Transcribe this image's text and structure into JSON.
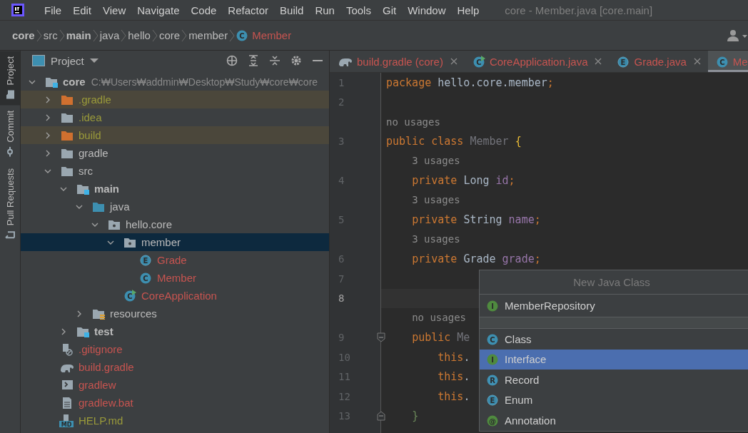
{
  "window": {
    "title": "core - Member.java [core.main]"
  },
  "menu": [
    "File",
    "Edit",
    "View",
    "Navigate",
    "Code",
    "Refactor",
    "Build",
    "Run",
    "Tools",
    "Git",
    "Window",
    "Help"
  ],
  "breadcrumb": [
    {
      "label": "core",
      "bold": true,
      "kind": "directory"
    },
    {
      "label": "src",
      "bold": false,
      "kind": "directory"
    },
    {
      "label": "main",
      "bold": true,
      "kind": "directory"
    },
    {
      "label": "java",
      "bold": false,
      "kind": "directory"
    },
    {
      "label": "hello",
      "bold": false,
      "kind": "directory"
    },
    {
      "label": "core",
      "bold": false,
      "kind": "directory"
    },
    {
      "label": "member",
      "bold": false,
      "kind": "directory"
    },
    {
      "label": "Member",
      "bold": false,
      "kind": "class",
      "badge": "C"
    }
  ],
  "tool_tabs": [
    {
      "label": "Project",
      "selected": true
    },
    {
      "label": "Commit",
      "selected": false
    },
    {
      "label": "Pull Requests",
      "selected": false
    }
  ],
  "project_panel": {
    "title": "Project",
    "tree": [
      {
        "name": "core",
        "path": "C:₩Users₩addmin₩Desktop₩Study₩core₩core",
        "kind": "module",
        "color": "#bbbbbb",
        "excluded": false,
        "expanded": true,
        "selected": false,
        "children": [
          {
            "name": ".gradle",
            "kind": "excluded-folder",
            "color": "#9a9a3a",
            "excluded": true,
            "expanded": false,
            "selected": false
          },
          {
            "name": ".idea",
            "kind": "folder",
            "color": "#9a9a3a",
            "excluded": false,
            "expanded": false,
            "selected": false
          },
          {
            "name": "build",
            "kind": "excluded-folder",
            "color": "#9a9a3a",
            "excluded": true,
            "expanded": false,
            "selected": false
          },
          {
            "name": "gradle",
            "kind": "folder",
            "color": "#bbbbbb",
            "excluded": false,
            "expanded": false,
            "selected": false
          },
          {
            "name": "src",
            "kind": "folder",
            "color": "#bbbbbb",
            "excluded": false,
            "expanded": true,
            "selected": false,
            "children": [
              {
                "name": "main",
                "kind": "source-root",
                "color": "#bbbbbb",
                "excluded": false,
                "expanded": true,
                "selected": false,
                "children": [
                  {
                    "name": "java",
                    "kind": "java-folder",
                    "color": "#bbbbbb",
                    "excluded": false,
                    "expanded": true,
                    "selected": false,
                    "children": [
                      {
                        "name": "hello.core",
                        "kind": "package",
                        "color": "#bbbbbb",
                        "excluded": false,
                        "expanded": true,
                        "selected": false,
                        "children": [
                          {
                            "name": "member",
                            "kind": "package",
                            "color": "#bbbbbb",
                            "excluded": false,
                            "expanded": true,
                            "selected": true,
                            "children": [
                              {
                                "name": "Grade",
                                "kind": "enum",
                                "badge": "E",
                                "color": "#c75450",
                                "excluded": false,
                                "selected": false
                              },
                              {
                                "name": "Member",
                                "kind": "class",
                                "badge": "C",
                                "color": "#c75450",
                                "excluded": false,
                                "selected": false
                              }
                            ]
                          },
                          {
                            "name": "CoreApplication",
                            "kind": "app-class",
                            "badge": "C",
                            "color": "#c75450",
                            "excluded": false,
                            "selected": false
                          }
                        ]
                      }
                    ]
                  },
                  {
                    "name": "resources",
                    "kind": "resources",
                    "color": "#bbbbbb",
                    "excluded": false,
                    "expanded": false,
                    "selected": false
                  }
                ]
              },
              {
                "name": "test",
                "kind": "source-root",
                "color": "#bbbbbb",
                "excluded": false,
                "expanded": false,
                "selected": false
              }
            ]
          },
          {
            "name": ".gitignore",
            "kind": "gitignore",
            "color": "#c75450",
            "excluded": false,
            "selected": false
          },
          {
            "name": "build.gradle",
            "kind": "gradle",
            "color": "#c75450",
            "excluded": false,
            "selected": false
          },
          {
            "name": "gradlew",
            "kind": "script",
            "color": "#c75450",
            "excluded": false,
            "selected": false
          },
          {
            "name": "gradlew.bat",
            "kind": "text",
            "color": "#c75450",
            "excluded": false,
            "selected": false
          },
          {
            "name": "HELP.md",
            "kind": "markdown",
            "badge": "MD",
            "color": "#9a9a3a",
            "excluded": false,
            "selected": false
          }
        ]
      }
    ]
  },
  "editor_tabs": [
    {
      "label": "build.gradle (core)",
      "kind": "gradle",
      "selected": false
    },
    {
      "label": "CoreApplication.java",
      "kind": "app-class",
      "badge": "C",
      "selected": false
    },
    {
      "label": "Grade.java",
      "kind": "enum",
      "badge": "E",
      "selected": false
    },
    {
      "label": "Me",
      "kind": "class",
      "badge": "C",
      "selected": true
    }
  ],
  "code": [
    {
      "kind": "line",
      "number": "1",
      "current": false,
      "fold_start": false,
      "fold_end": false,
      "tokens": [
        {
          "kind": "keyword",
          "text": "package"
        },
        {
          "kind": "plain",
          "text": " hello.core.member"
        },
        {
          "kind": "keyword",
          "text": ";"
        }
      ]
    },
    {
      "kind": "line",
      "number": "2",
      "current": false,
      "fold_start": false,
      "fold_end": false
    },
    {
      "kind": "hint",
      "text": "no usages"
    },
    {
      "kind": "line",
      "number": "3",
      "current": false,
      "fold_start": false,
      "fold_end": false,
      "tokens": [
        {
          "kind": "keyword",
          "text": "public class"
        },
        {
          "kind": "unused",
          "text": " Member"
        },
        {
          "kind": "brace",
          "text": " {"
        }
      ]
    },
    {
      "kind": "hint",
      "text": "    3 usages"
    },
    {
      "kind": "line",
      "number": "4",
      "current": false,
      "fold_start": false,
      "fold_end": false,
      "tokens": [
        {
          "kind": "keyword",
          "text": "    private"
        },
        {
          "kind": "plain",
          "text": " Long"
        },
        {
          "kind": "field",
          "text": " id"
        },
        {
          "kind": "keyword",
          "text": ";"
        }
      ]
    },
    {
      "kind": "hint",
      "text": "    3 usages"
    },
    {
      "kind": "line",
      "number": "5",
      "current": false,
      "fold_start": false,
      "fold_end": false,
      "tokens": [
        {
          "kind": "keyword",
          "text": "    private"
        },
        {
          "kind": "plain",
          "text": " String"
        },
        {
          "kind": "field",
          "text": " name"
        },
        {
          "kind": "keyword",
          "text": ";"
        }
      ]
    },
    {
      "kind": "hint",
      "text": "    3 usages"
    },
    {
      "kind": "line",
      "number": "6",
      "current": false,
      "fold_start": false,
      "fold_end": false,
      "tokens": [
        {
          "kind": "keyword",
          "text": "    private"
        },
        {
          "kind": "plain",
          "text": " Grade"
        },
        {
          "kind": "field",
          "text": " grade"
        },
        {
          "kind": "keyword",
          "text": ";"
        }
      ]
    },
    {
      "kind": "line",
      "number": "7",
      "current": false,
      "fold_start": false,
      "fold_end": false
    },
    {
      "kind": "line",
      "number": "8",
      "current": true,
      "fold_start": false,
      "fold_end": false
    },
    {
      "kind": "hint",
      "text": "    no usages"
    },
    {
      "kind": "line",
      "number": "9",
      "current": false,
      "fold_start": true,
      "fold_end": false,
      "tokens": [
        {
          "kind": "keyword",
          "text": "    public"
        },
        {
          "kind": "unused",
          "text": " Me"
        }
      ]
    },
    {
      "kind": "line",
      "number": "10",
      "current": false,
      "fold_start": false,
      "fold_end": false,
      "tokens": [
        {
          "kind": "keyword",
          "text": "        this"
        },
        {
          "kind": "plain",
          "text": "."
        }
      ]
    },
    {
      "kind": "line",
      "number": "11",
      "current": false,
      "fold_start": false,
      "fold_end": false,
      "tokens": [
        {
          "kind": "keyword",
          "text": "        this"
        },
        {
          "kind": "plain",
          "text": "."
        }
      ]
    },
    {
      "kind": "line",
      "number": "12",
      "current": false,
      "fold_start": false,
      "fold_end": false,
      "tokens": [
        {
          "kind": "keyword",
          "text": "        this"
        },
        {
          "kind": "plain",
          "text": "."
        }
      ]
    },
    {
      "kind": "line",
      "number": "13",
      "current": false,
      "fold_start": false,
      "fold_end": true,
      "tokens": [
        {
          "kind": "matched-brace",
          "text": "    }"
        }
      ]
    }
  ],
  "popup": {
    "title": "New Java Class",
    "name_item": {
      "label": "MemberRepository",
      "kind": "interface",
      "badge": "I"
    },
    "items": [
      {
        "label": "Class",
        "kind": "class",
        "badge": "C",
        "selected": false
      },
      {
        "label": "Interface",
        "kind": "interface",
        "badge": "I",
        "selected": true
      },
      {
        "label": "Record",
        "kind": "record",
        "badge": "R",
        "selected": false
      },
      {
        "label": "Enum",
        "kind": "enum",
        "badge": "E",
        "selected": false
      },
      {
        "label": "Annotation",
        "kind": "annotation",
        "badge": "@",
        "selected": false
      }
    ]
  }
}
